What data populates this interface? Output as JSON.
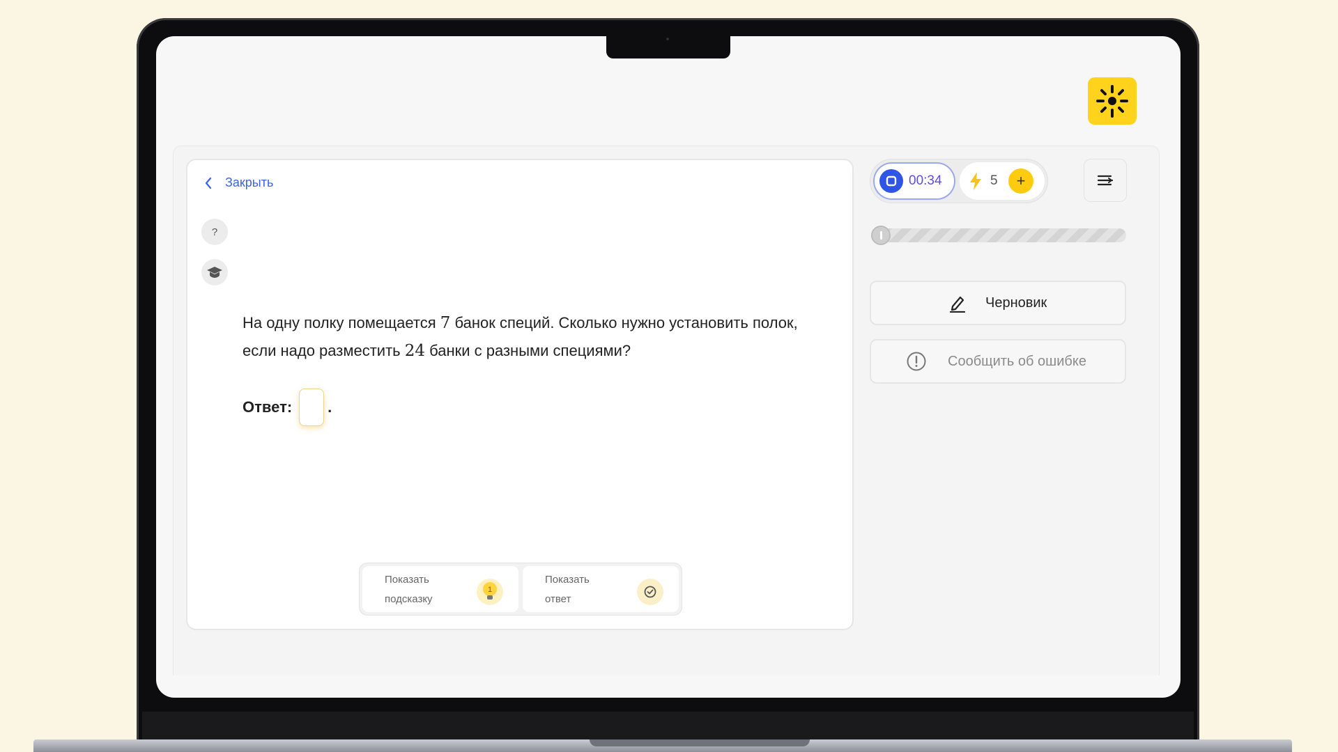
{
  "header": {
    "close_label": "Закрыть"
  },
  "side_buttons": {
    "help_label": "?"
  },
  "question": {
    "part1": "На одну полку помещается ",
    "num1": "7",
    "part2": " банок специй. Сколько нужно установить полок, если надо разместить ",
    "num2": "24",
    "part3": " банки с разными специями?"
  },
  "answer": {
    "label": "Ответ:",
    "value": "",
    "suffix": "."
  },
  "hints": {
    "show_hint_line1": "Показать",
    "show_hint_line2": "подсказку",
    "hint_count": "1",
    "show_answer_line1": "Показать",
    "show_answer_line2": "ответ"
  },
  "timer": {
    "time": "00:34"
  },
  "energy": {
    "count": "5",
    "plus_label": "+"
  },
  "progress": {
    "value": 0
  },
  "actions": {
    "draft_label": "Черновик",
    "report_label": "Сообщить об ошибке"
  },
  "colors": {
    "accent_blue": "#3a63e8",
    "brand_yellow": "#ffd21c",
    "timer_purple": "#5b4fd9"
  },
  "icons": [
    "sun-logo-icon",
    "chevron-left-icon",
    "graduation-cap-icon",
    "lightbulb-icon",
    "check-circle-icon",
    "stop-icon",
    "lightning-icon",
    "menu-icon",
    "pencil-icon",
    "exclamation-circle-icon"
  ]
}
